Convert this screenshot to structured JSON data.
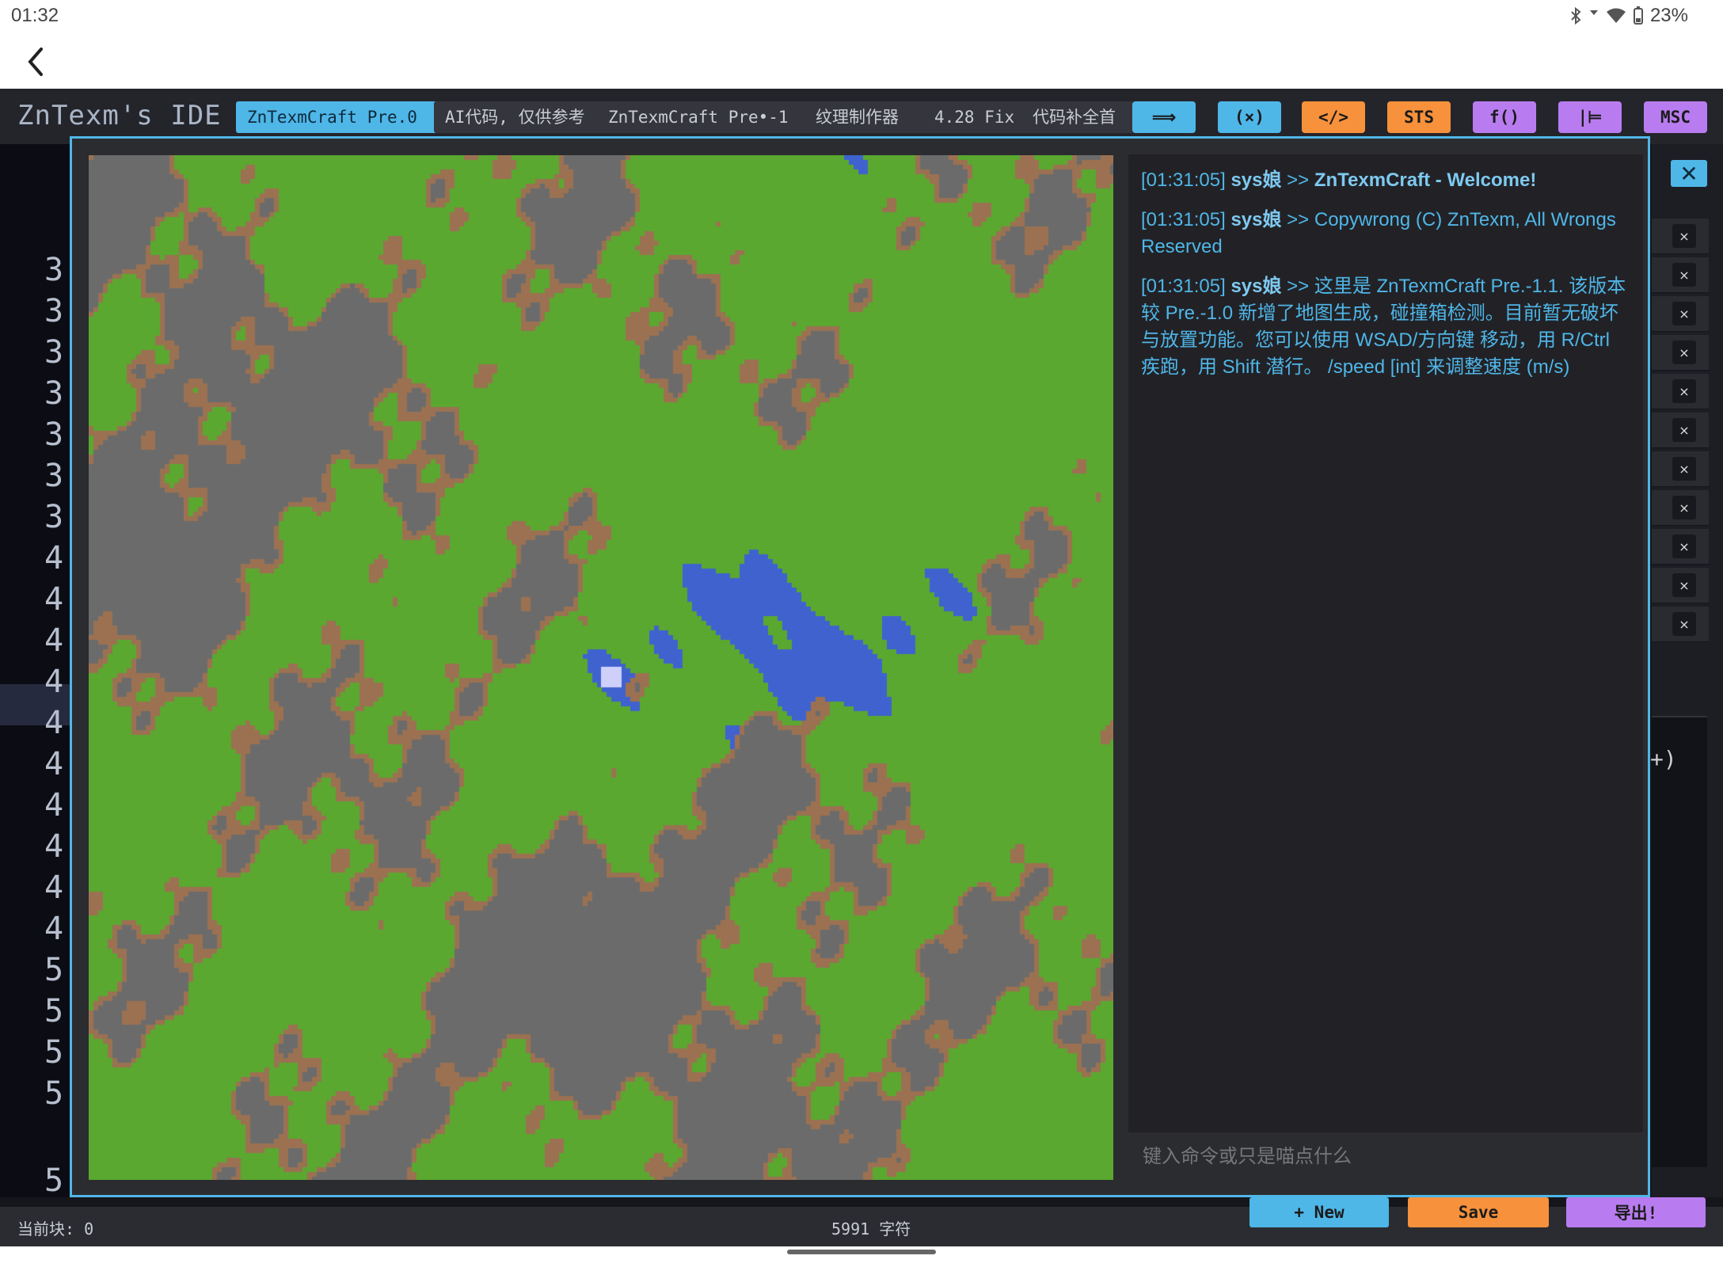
{
  "status_bar": {
    "time": "01:32",
    "battery": "23%"
  },
  "ide": {
    "title": "ZnTexm's IDE",
    "tabs": [
      {
        "label": "ZnTexmCraft Pre.0",
        "active": true
      },
      {
        "label": "AI代码, 仅供参考",
        "active": false
      },
      {
        "label": "ZnTexmCraft Pre•-1",
        "active": false
      },
      {
        "label": "纹理制作器",
        "active": false
      },
      {
        "label": "4.28 Fix",
        "active": false
      },
      {
        "label": "代码补全首",
        "active": false
      }
    ],
    "toolbar_buttons": [
      {
        "label": "⟹",
        "color": "#4fb6e8"
      },
      {
        "label": "(×)",
        "color": "#4fb6e8"
      },
      {
        "label": "</>",
        "color": "#f7913b"
      },
      {
        "label": "STS",
        "color": "#f7913b"
      },
      {
        "label": "f()",
        "color": "#b97cf0"
      },
      {
        "label": "|⊨",
        "color": "#b97cf0"
      },
      {
        "label": "MSC",
        "color": "#b97cf0"
      }
    ],
    "line_numbers": [
      "3",
      "3",
      "3",
      "3",
      "3",
      "3",
      "3",
      "4",
      "4",
      "4",
      "4",
      "4",
      "4",
      "4",
      "4",
      "4",
      "4",
      "5",
      "5",
      "5",
      "5",
      "5"
    ],
    "side_row_close": "×",
    "side_paren": "+)",
    "footer": {
      "current_block": "当前块: 0",
      "char_count": "5991 字符"
    },
    "footer_buttons": {
      "new_label": "+ New",
      "save_label": "Save",
      "export_label": "导出!"
    }
  },
  "game": {
    "console_log": [
      {
        "time": "[01:31:05]",
        "user": "sys娘",
        "sep": ">>",
        "message": "ZnTexmCraft - Welcome!",
        "bold": true
      },
      {
        "time": "[01:31:05]",
        "user": "sys娘",
        "sep": ">>",
        "message": "Copywrong (C) ZnTexm, All Wrongs Reserved",
        "bold": false
      },
      {
        "time": "[01:31:05]",
        "user": "sys娘",
        "sep": ">>",
        "message": "这里是 ZnTexmCraft Pre.-1.1. 该版本较 Pre.-1.0 新增了地图生成，碰撞箱检测。目前暂无破坏与放置功能。您可以使用 WSAD/方向键 移动，用 R/Ctrl 疾跑，用 Shift 潜行。 /speed [int] 来调整速度 (m/s)",
        "bold": false
      }
    ],
    "input_placeholder": "键入命令或只是喵点什么",
    "close_label": "✕",
    "terrain_colors": {
      "grass": "#5aa82f",
      "stone": "#6b6b6b",
      "dirt": "#9b7152",
      "water": "#3f62cf",
      "player": "#cfd0fa"
    }
  }
}
